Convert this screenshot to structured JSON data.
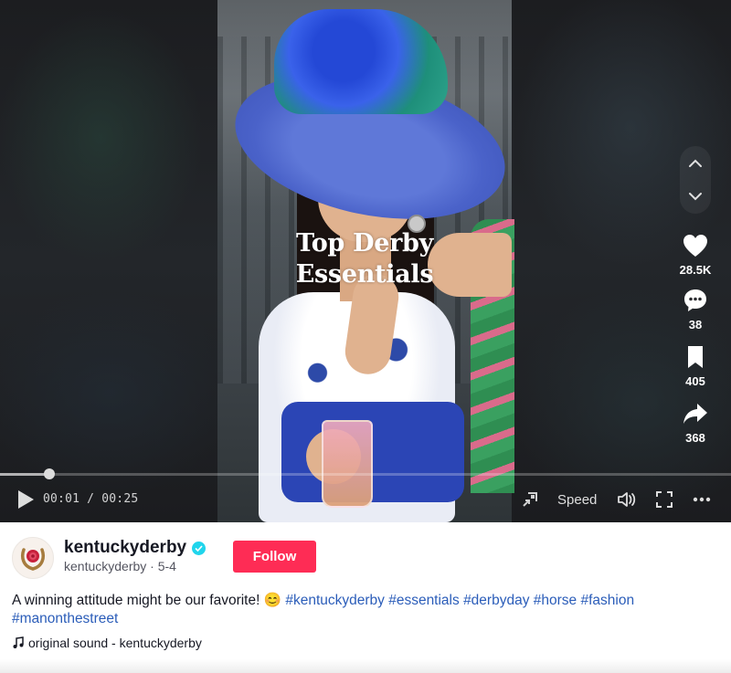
{
  "video": {
    "overlay_line1": "Top Derby",
    "overlay_line2": "Essentials",
    "progress_fraction": 0.04,
    "time_current": "00:01",
    "time_total": "00:25",
    "time_separator": " / ",
    "speed_label": "Speed"
  },
  "actions": {
    "likes": "28.5K",
    "comments": "38",
    "saves": "405",
    "shares": "368"
  },
  "author": {
    "username": "kentuckyderby",
    "handle": "kentuckyderby",
    "date": "5-4",
    "separator": " · ",
    "follow_label": "Follow"
  },
  "caption": {
    "text": "A winning attitude might be our favorite! 😊",
    "hashtags": [
      "#kentuckyderby",
      "#essentials",
      "#derbyday",
      "#horse",
      "#fashion",
      "#manonthestreet"
    ]
  },
  "sound": {
    "label": "original sound - kentuckyderby"
  },
  "colors": {
    "follow": "#fe2c55",
    "hashtag": "#2b5db9",
    "verified": "#20d5ec"
  },
  "icons": [
    "play-icon",
    "chevron-up-icon",
    "chevron-down-icon",
    "heart-icon",
    "comment-icon",
    "bookmark-icon",
    "share-icon",
    "pip-icon",
    "volume-icon",
    "fullscreen-icon",
    "more-icon",
    "music-note-icon",
    "verified-icon"
  ]
}
